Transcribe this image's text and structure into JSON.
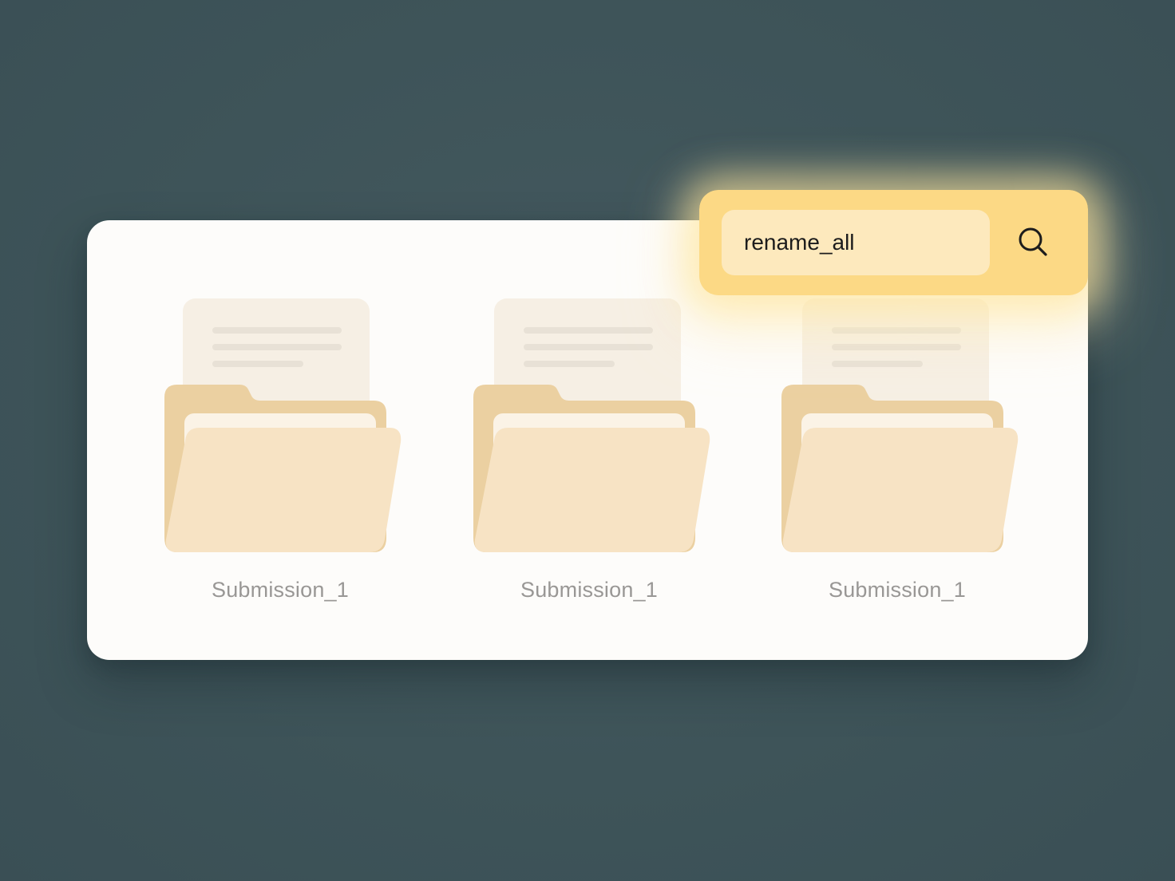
{
  "search": {
    "value": "rename_all",
    "icon": "search-icon"
  },
  "folders": [
    {
      "label": "Submission_1",
      "icon": "folder-icon"
    },
    {
      "label": "Submission_1",
      "icon": "folder-icon"
    },
    {
      "label": "Submission_1",
      "icon": "folder-icon"
    }
  ],
  "colors": {
    "background": "#3e5459",
    "panel": "#fdfcfa",
    "search_bar": "#fcd985",
    "search_field": "#fde9bd",
    "folder_back": "#ebd0a1",
    "folder_front": "#f7e3c4",
    "document": "#f6efe4",
    "label_text": "#999795"
  }
}
